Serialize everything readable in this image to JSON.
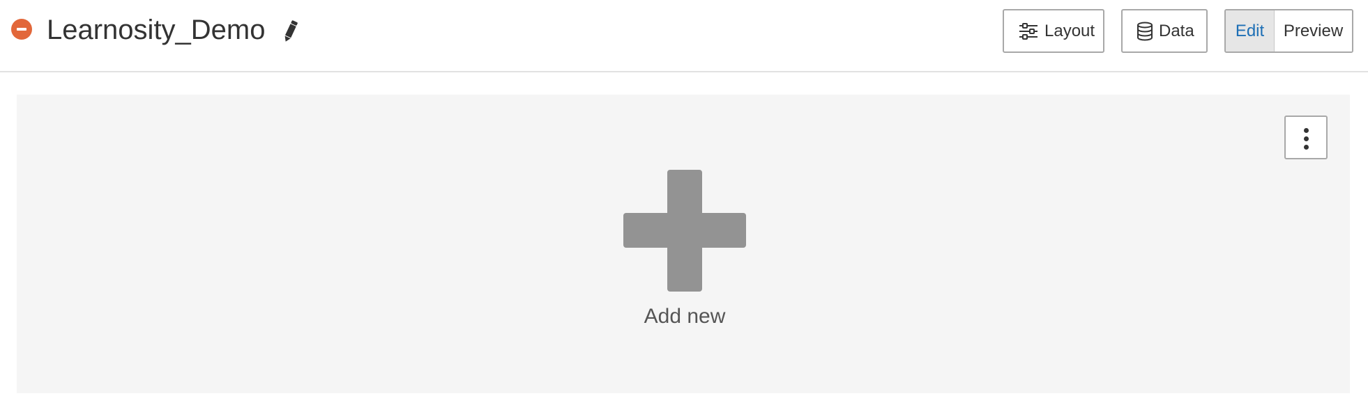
{
  "header": {
    "title": "Learnosity_Demo",
    "remove_icon": "minus-circle-icon",
    "edit_icon": "pencil-icon",
    "accent_color": "#e2673a"
  },
  "toolbar": {
    "layout_label": "Layout",
    "layout_icon": "sliders-icon",
    "data_label": "Data",
    "data_icon": "database-icon",
    "mode_toggle": {
      "options": [
        "Edit",
        "Preview"
      ],
      "selected": "Edit",
      "selected_color": "#1d6fb5"
    }
  },
  "canvas": {
    "menu_icon": "vertical-ellipsis-icon",
    "add_new_icon": "plus-icon",
    "add_new_label": "Add new"
  }
}
